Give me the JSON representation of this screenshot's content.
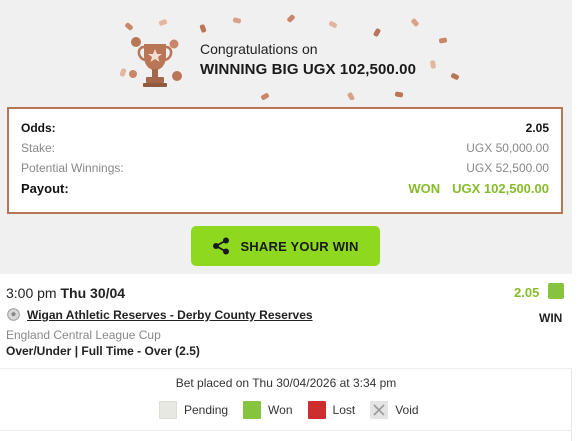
{
  "banner": {
    "congrats": "Congratulations on",
    "headline": "WINNING BIG UGX 102,500.00",
    "accent_color": "#b87656"
  },
  "summary": {
    "odds_label": "Odds:",
    "odds_value": "2.05",
    "stake_label": "Stake:",
    "stake_value": "UGX 50,000.00",
    "potential_label": "Potential Winnings:",
    "potential_value": "UGX 52,500.00",
    "payout_label": "Payout:",
    "payout_status": "WON",
    "payout_value": "UGX 102,500.00",
    "win_color": "#86bc2b"
  },
  "share": {
    "label": "SHARE YOUR WIN",
    "icon": "share-icon",
    "color": "#8ed81f"
  },
  "bet": {
    "time": "3:00 pm",
    "day": "Thu 30/04",
    "odds": "2.05",
    "match": "Wigan Athletic Reserves - Derby County Reserves",
    "result": "WIN",
    "league": "England Central League Cup",
    "market": "Over/Under | Full Time - Over (2.5)",
    "sport_icon": "soccer-ball-icon"
  },
  "footer": {
    "placed": "Bet placed on Thu 30/04/2026 at 3:34 pm",
    "legend": {
      "pending": "Pending",
      "won": "Won",
      "lost": "Lost",
      "void": "Void"
    },
    "colors": {
      "pending": "#e8e8e3",
      "won": "#86c440",
      "lost": "#cc2e2e",
      "void": "#e4e4e4"
    }
  }
}
